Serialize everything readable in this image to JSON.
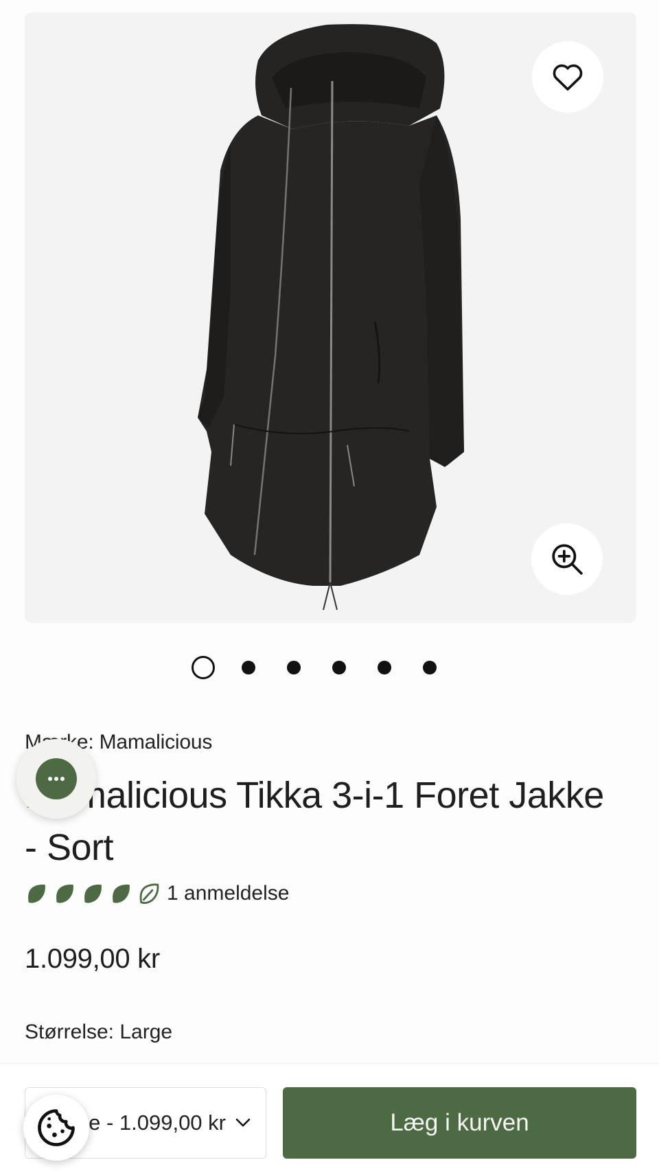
{
  "product": {
    "vendor_label": "Mærke: Mamalicious",
    "title": "Mamalicious Tikka 3-i-1 Foret Jakke - Sort",
    "rating_value": 4,
    "rating_max": 5,
    "reviews_text": "1 anmeldelse",
    "price": "1.099,00 kr",
    "size_label": "Størrelse: Large"
  },
  "gallery": {
    "image_count": 6,
    "active_index": 0,
    "wishlist_icon": "heart-outline-icon",
    "zoom_icon": "zoom-in-icon"
  },
  "cart_bar": {
    "variant_value": "Large - 1.099,00 kr",
    "add_to_cart_label": "Læg i kurven"
  },
  "widgets": {
    "chat_icon": "chat-bubble-icon",
    "cookie_icon": "cookie-icon"
  },
  "colors": {
    "brand_green": "#4e6a45",
    "image_bg": "#f3f3f3",
    "text": "#1e1e1e"
  }
}
